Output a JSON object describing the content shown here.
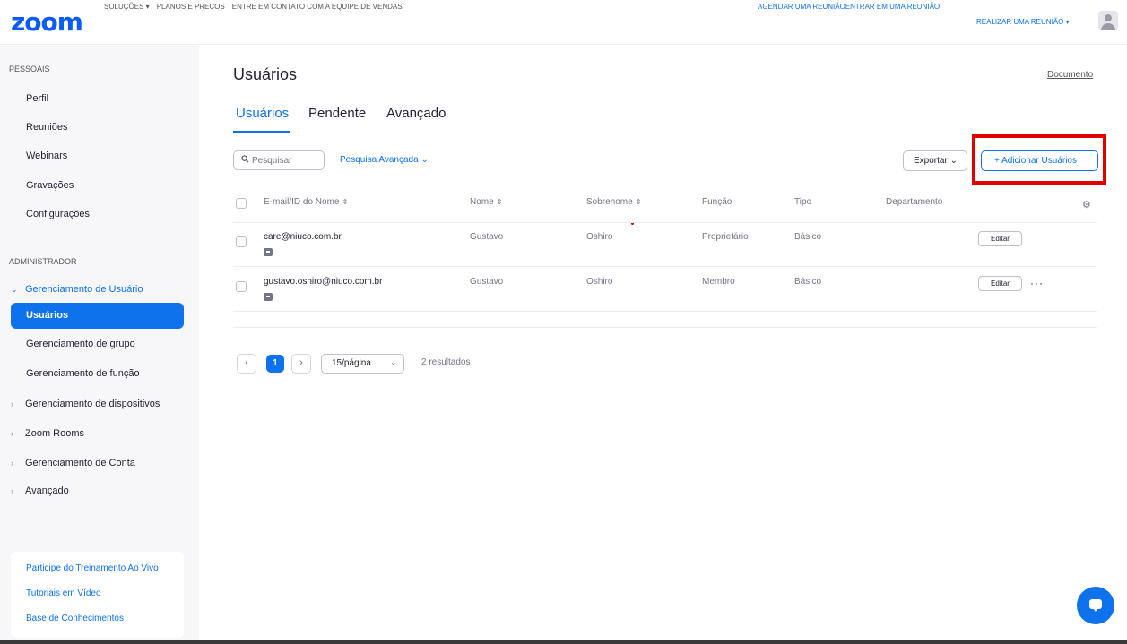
{
  "header": {
    "logo": "zoom",
    "nav": [
      "SOLUÇÕES ▾",
      "PLANOS E PREÇOS",
      "ENTRE EM CONTATO COM A EQUIPE DE VENDAS"
    ],
    "schedule": "AGENDAR UMA REUNIÃO",
    "join": "ENTRAR EM UMA REUNIÃO",
    "host": "REALIZAR UMA REUNIÃO ▾"
  },
  "sidebar": {
    "personal_title": "PESSOAIS",
    "personal_items": [
      "Perfil",
      "Reuniões",
      "Webinars",
      "Gravações",
      "Configurações"
    ],
    "admin_title": "ADMINISTRADOR",
    "user_mgmt": "Gerenciamento de Usuário",
    "active_item": "Usuários",
    "sub_items": [
      "Gerenciamento de grupo",
      "Gerenciamento de função"
    ],
    "groups": [
      "Gerenciamento de dispositivos",
      "Zoom Rooms",
      "Gerenciamento de Conta",
      "Avançado"
    ],
    "help_links": [
      "Participe do Treinamento Ao Vivo",
      "Tutoriais em Vídeo",
      "Base de Conhecimentos"
    ]
  },
  "main": {
    "title": "Usuários",
    "doc_link": "Documento",
    "tabs": [
      "Usuários",
      "Pendente",
      "Avançado"
    ],
    "search_placeholder": "Pesquisar",
    "advanced_search": "Pesquisa Avançada ⌄",
    "export": "Exportar ⌄",
    "add_users": "+  Adicionar Usuários",
    "columns": [
      "E-mail/ID do Nome",
      "Nome",
      "Sobrenome",
      "Função",
      "Tipo",
      "Departamento"
    ],
    "rows": [
      {
        "email": "care@niuco.com.br",
        "first": "Gustavo",
        "last": "Oshiro",
        "role": "Proprietário",
        "type": "Básico",
        "dept": "",
        "edit": "Editar"
      },
      {
        "email": "gustavo.oshiro@niuco.com.br",
        "first": "Gustavo",
        "last": "Oshiro",
        "role": "Membro",
        "type": "Básico",
        "dept": "",
        "edit": "Editar"
      }
    ],
    "pagination": {
      "current": "1",
      "per_page": "15/página",
      "results": "2 resultados"
    }
  }
}
